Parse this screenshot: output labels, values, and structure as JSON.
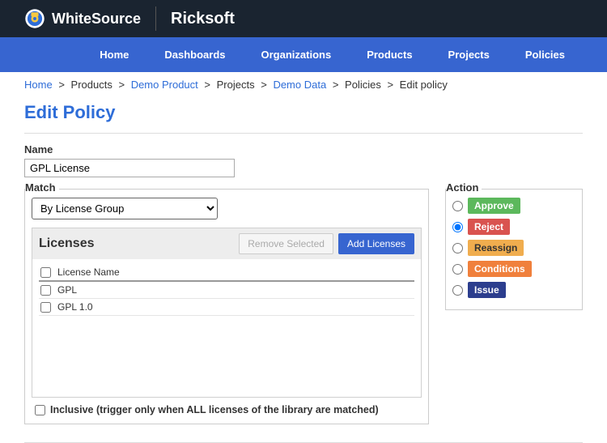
{
  "brand": "WhiteSource",
  "partner": "Ricksoft",
  "nav": [
    "Home",
    "Dashboards",
    "Organizations",
    "Products",
    "Projects",
    "Policies"
  ],
  "breadcrumb": {
    "items": [
      {
        "label": "Home",
        "link": true
      },
      {
        "label": "Products",
        "link": false
      },
      {
        "label": "Demo Product",
        "link": true
      },
      {
        "label": "Projects",
        "link": false
      },
      {
        "label": "Demo Data",
        "link": true
      },
      {
        "label": "Policies",
        "link": false
      },
      {
        "label": "Edit policy",
        "link": false
      }
    ],
    "sep": ">"
  },
  "page_title": "Edit Policy",
  "name_label": "Name",
  "name_value": "GPL License",
  "match_label": "Match",
  "match_select_value": "By License Group",
  "licenses_title": "Licenses",
  "remove_selected_label": "Remove Selected",
  "add_licenses_label": "Add Licenses",
  "license_header": "License Name",
  "license_rows": [
    "GPL",
    "GPL 1.0"
  ],
  "inclusive_label": "Inclusive (trigger only when ALL licenses of the library are matched)",
  "action_label": "Action",
  "actions": [
    {
      "label": "Approve",
      "color": "#5cb85c",
      "selected": false
    },
    {
      "label": "Reject",
      "color": "#d9534f",
      "selected": true
    },
    {
      "label": "Reassign",
      "color": "#f0ad4e",
      "selected": false
    },
    {
      "label": "Conditions",
      "color": "#f0803c",
      "selected": false
    },
    {
      "label": "Issue",
      "color": "#2c3e8e",
      "selected": false
    }
  ]
}
